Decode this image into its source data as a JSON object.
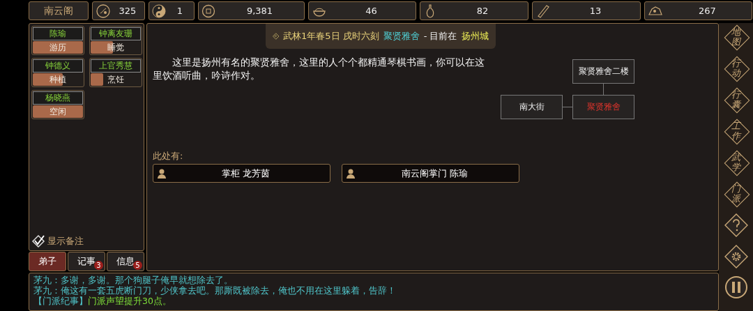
{
  "top_bar": {
    "sect_name": "南云阁",
    "stats": [
      {
        "kind": "medallion",
        "value": "325"
      },
      {
        "kind": "yinyang",
        "value": "1"
      },
      {
        "kind": "coin",
        "value": "9,381"
      },
      {
        "kind": "bowl",
        "value": "46"
      },
      {
        "kind": "gourd",
        "value": "82"
      },
      {
        "kind": "scroll",
        "value": "13"
      },
      {
        "kind": "ore",
        "value": "267"
      }
    ]
  },
  "disciples": [
    {
      "name": "陈瑜",
      "activity": "游历",
      "level": 1.0
    },
    {
      "name": "钟离友珊",
      "activity": "睡觉",
      "level": 0.45
    },
    {
      "name": "钟德义",
      "activity": "种植",
      "level": 0.6
    },
    {
      "name": "上官秀慧",
      "activity": "烹饪",
      "level": 0.25
    },
    {
      "name": "杨晓燕",
      "activity": "空闲",
      "level": 1.0
    }
  ],
  "show_notes": {
    "label": "显示备注",
    "checked": true
  },
  "tabs": [
    {
      "label": "弟子",
      "selected": true
    },
    {
      "label": "记事",
      "selected": false,
      "badge": "3"
    },
    {
      "label": "信息",
      "selected": false,
      "badge": "5"
    }
  ],
  "header": {
    "date": "武林1年春5日 戌时六刻",
    "place": "聚贤雅舍",
    "separator": "- 目前在",
    "city": "扬州城"
  },
  "description": "这里是扬州有名的聚贤雅舍，这里的人个个都精通琴棋书画，你可以在这里饮酒听曲，吟诗作对。",
  "map": {
    "nodes": [
      {
        "label": "聚贤雅舍二楼",
        "selected": false
      },
      {
        "label": "南大街",
        "selected": false
      },
      {
        "label": "聚贤雅舍",
        "selected": true
      }
    ]
  },
  "presence": {
    "label": "此处有:",
    "people": [
      "掌柜 龙芳茵",
      "南云阁掌门 陈瑜"
    ]
  },
  "sidebar": [
    {
      "kind": "text",
      "label": "地图"
    },
    {
      "kind": "text",
      "label": "行动"
    },
    {
      "kind": "text",
      "label": "行囊"
    },
    {
      "kind": "text",
      "label": "工作"
    },
    {
      "kind": "text",
      "label": "武学"
    },
    {
      "kind": "text",
      "label": "门派"
    },
    {
      "kind": "help"
    },
    {
      "kind": "settings"
    },
    {
      "kind": "pause"
    }
  ],
  "log": [
    [
      {
        "kind": "speech",
        "text": "茅九：多谢，多谢。那个狗腿子俺早就想除去了。"
      }
    ],
    [
      {
        "kind": "speech",
        "text": "茅九：俺这有一套五虎断门刀，少侠拿去吧。那厮既被除去，俺也不用在这里躲着，告辞！"
      }
    ],
    [
      {
        "kind": "speech",
        "text": "【门派纪事】"
      },
      {
        "kind": "event",
        "text": "门派声望提升30点。"
      }
    ]
  ]
}
